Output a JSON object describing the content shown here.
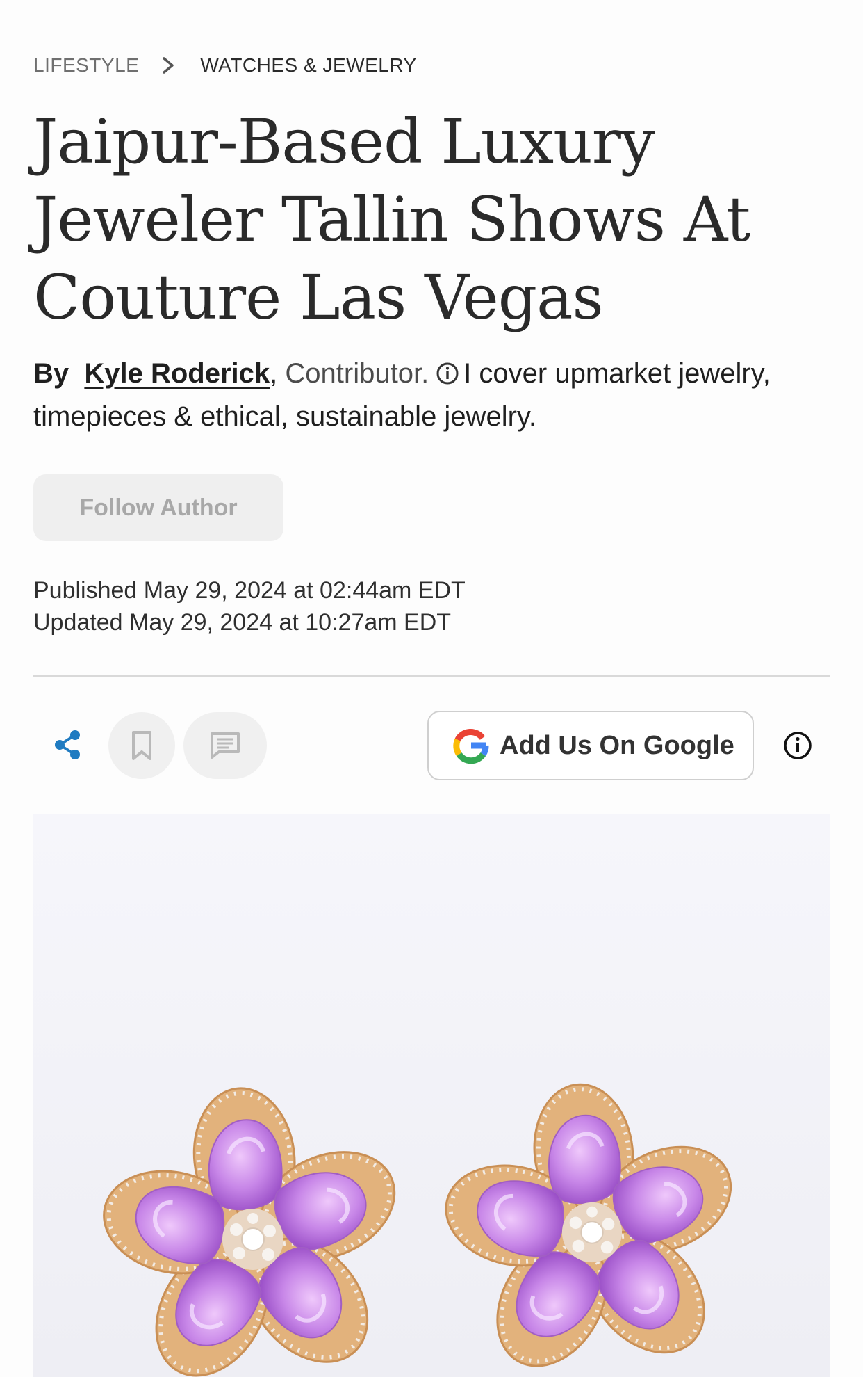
{
  "breadcrumb": {
    "section": "LIFESTYLE",
    "subsection": "WATCHES & JEWELRY"
  },
  "article": {
    "title": "Jaipur-Based Luxury Jeweler Tallin Shows At Couture Las Vegas",
    "byline": {
      "by_label": "By",
      "author": "Kyle Roderick",
      "comma": ",",
      "role": "Contributor.",
      "bio": "I cover upmarket jewelry, timepieces & ethical, sustainable jewelry."
    },
    "follow_label": "Follow Author",
    "published": "Published May 29, 2024 at 02:44am EDT",
    "updated": "Updated May 29, 2024 at 10:27am EDT"
  },
  "toolbar": {
    "google_label": "Add Us On Google",
    "icons": [
      "share-icon",
      "bookmark-icon",
      "comment-icon",
      "google-g-icon",
      "info-icon"
    ]
  },
  "colors": {
    "share_accent": "#1f7bc1",
    "petal": "#c887e8",
    "gold": "#e2b27c"
  }
}
